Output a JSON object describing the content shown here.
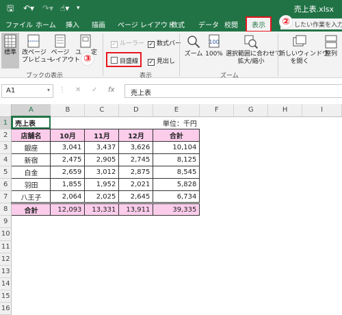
{
  "window": {
    "title": "売上表.xlsx"
  },
  "quick_access": {
    "save": "🖫",
    "undo": "↶▾",
    "redo": "↷▾",
    "touch": "☝▾"
  },
  "tabs": [
    "ファイル",
    "ホーム",
    "挿入",
    "描画",
    "ページ レイアウト",
    "数式",
    "データ",
    "校閲",
    "表示"
  ],
  "tell_me": "したい作業を入力してくださ",
  "ribbon": {
    "workbook_views": {
      "normal": "標準",
      "page_break_1": "改ページ",
      "page_break_2": "プレビュー",
      "page_layout_1": "ページ",
      "page_layout_2": "レイアウト",
      "custom_1": "ユ",
      "custom_2": "定",
      "group_label": "ブックの表示"
    },
    "show": {
      "ruler": "ルーラー",
      "formula_bar": "数式バー",
      "gridlines": "目盛線",
      "headings": "見出し",
      "group_label": "表示"
    },
    "zoom": {
      "zoom": "ズーム",
      "hundred": "100%",
      "fit_1": "選択範囲に合わせて",
      "fit_2": "拡大/縮小",
      "group_label": "ズーム"
    },
    "window": {
      "new_window_1": "新しいウィンドウ",
      "new_window_2": "を開く",
      "arrange": "整列"
    }
  },
  "callouts": {
    "two": "②",
    "three": "③"
  },
  "formula_bar": {
    "name_box": "A1",
    "cancel": "✕",
    "enter": "✓",
    "fx": "fx",
    "content": "売上表"
  },
  "sheet": {
    "columns": [
      "A",
      "B",
      "C",
      "D",
      "E",
      "F",
      "G",
      "H",
      "I"
    ],
    "title": "売上表",
    "unit": "単位：千円",
    "header": [
      "店舗名",
      "10月",
      "11月",
      "12月",
      "合計"
    ],
    "rows": [
      [
        "銀座",
        "3,041",
        "3,437",
        "3,626",
        "10,104"
      ],
      [
        "新宿",
        "2,475",
        "2,905",
        "2,745",
        "8,125"
      ],
      [
        "白金",
        "2,659",
        "3,012",
        "2,875",
        "8,545"
      ],
      [
        "羽田",
        "1,855",
        "1,952",
        "2,021",
        "5,828"
      ],
      [
        "八王子",
        "2,064",
        "2,025",
        "2,645",
        "6,734"
      ]
    ],
    "total": [
      "合計",
      "12,093",
      "13,331",
      "13,911",
      "39,335"
    ],
    "row_numbers": [
      "1",
      "2",
      "3",
      "4",
      "5",
      "6",
      "7",
      "8",
      "9",
      "10",
      "11",
      "12",
      "13",
      "14",
      "15",
      "16"
    ]
  },
  "colors": {
    "excel_green": "#217346",
    "highlight_red": "#e8141e",
    "header_pink": "#fbcdeb"
  }
}
